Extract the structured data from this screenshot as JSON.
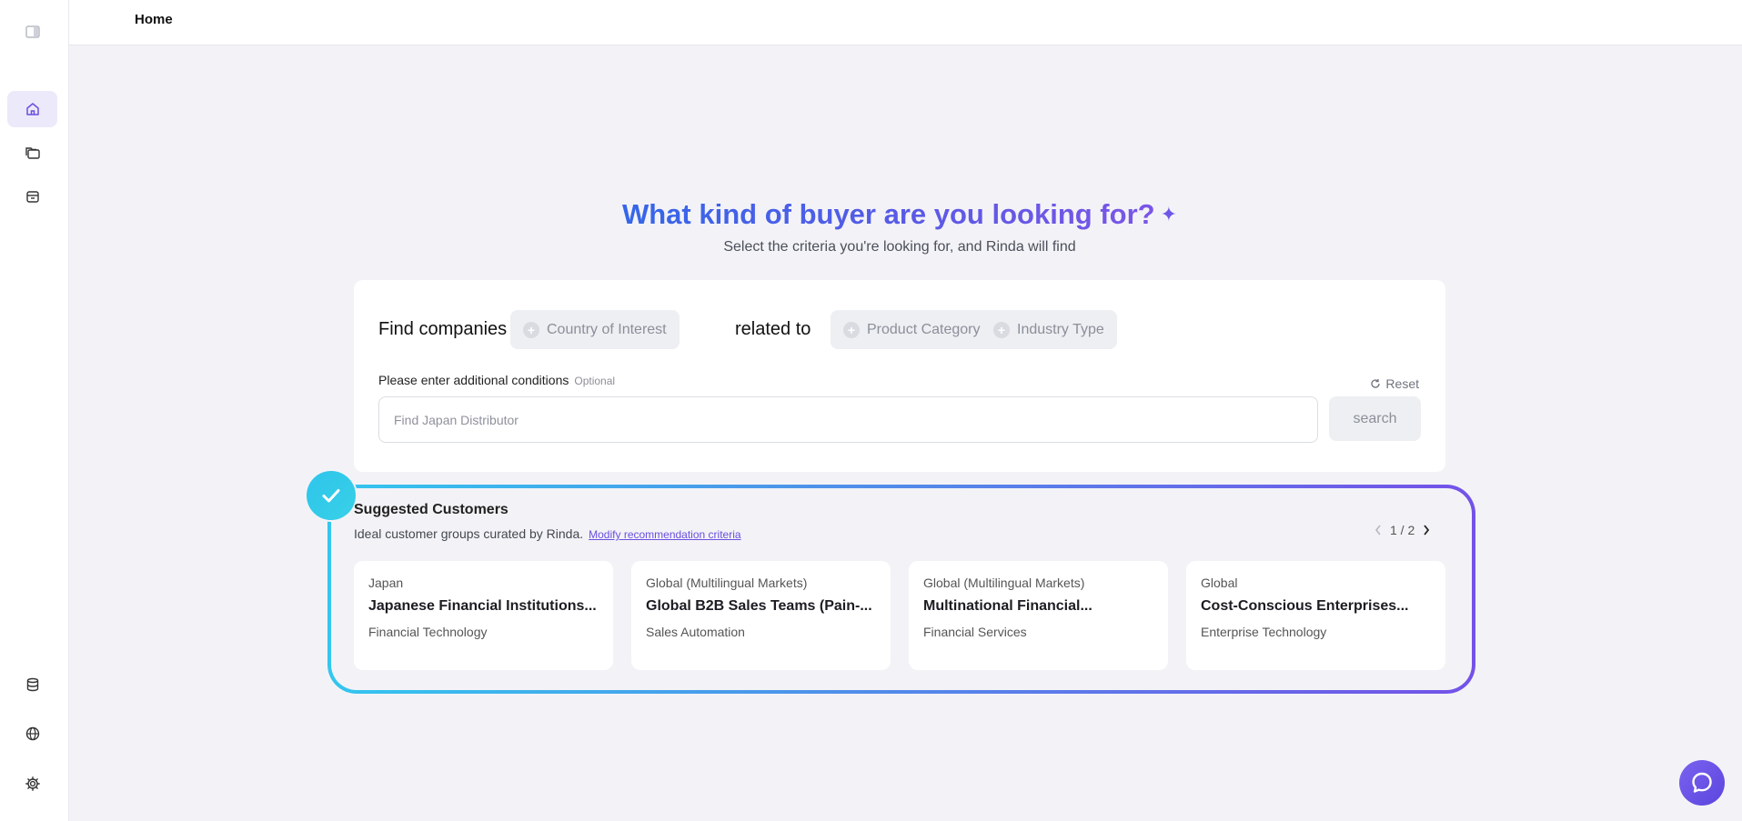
{
  "header": {
    "title": "Home"
  },
  "sidebar": {
    "top_icons": [
      "panel-toggle-icon"
    ],
    "nav": [
      {
        "icon": "home-icon",
        "active": true
      },
      {
        "icon": "folders-icon",
        "active": false
      },
      {
        "icon": "inbox-icon",
        "active": false
      }
    ],
    "bottom_icons": [
      "database-icon",
      "globe-icon",
      "gear-icon"
    ]
  },
  "hero": {
    "title": "What kind of buyer are you looking for?",
    "subtitle": "Select the criteria you're looking for, and Rinda will find"
  },
  "search": {
    "find_label": "Find companies in",
    "related_label": "related to",
    "chips": {
      "country": "Country of Interest",
      "product": "Product Category",
      "industry": "Industry Type"
    },
    "conditions_label": "Please enter additional conditions",
    "optional_label": "Optional",
    "reset_label": "Reset",
    "input_placeholder": "Find Japan Distributor",
    "search_label": "search"
  },
  "suggested": {
    "title": "Suggested Customers",
    "description": "Ideal customer groups curated by Rinda.",
    "modify_link": "Modify recommendation criteria",
    "pager": "1 / 2",
    "cards": [
      {
        "region": "Japan",
        "name": "Japanese Financial Institutions...",
        "industry": "Financial Technology"
      },
      {
        "region": "Global (Multilingual Markets)",
        "name": "Global B2B Sales Teams (Pain-...",
        "industry": "Sales Automation"
      },
      {
        "region": "Global (Multilingual Markets)",
        "name": "Multinational Financial...",
        "industry": "Financial Services"
      },
      {
        "region": "Global",
        "name": "Cost-Conscious Enterprises...",
        "industry": "Enterprise Technology"
      }
    ]
  },
  "colors": {
    "accent": "#6a4fe0",
    "title_gradient_start": "#3566e8",
    "title_gradient_end": "#7b55e6",
    "frame_gradient_start": "#33c6ee",
    "frame_gradient_end": "#7452e8"
  }
}
